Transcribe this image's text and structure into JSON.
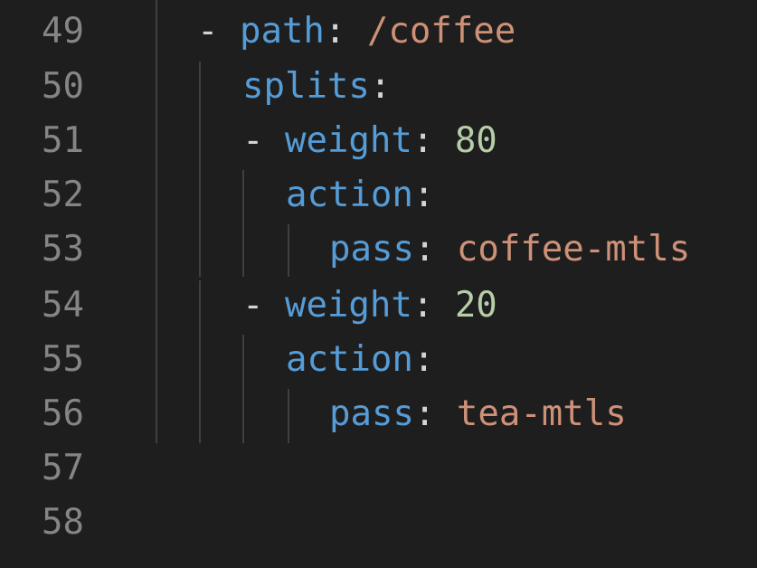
{
  "editor": {
    "colors": {
      "background": "#1e1e1e",
      "line_number": "#858585",
      "key": "#569cd6",
      "string": "#ce9178",
      "number": "#b5cea8",
      "punctuation": "#d4d4d4",
      "indent_guide": "#404040"
    },
    "lines": [
      {
        "number": "49",
        "dash": "- ",
        "key": "path",
        "colon": ": ",
        "value": "/coffee",
        "value_type": "string"
      },
      {
        "number": "50",
        "dash": "",
        "key": "splits",
        "colon": ":",
        "value": "",
        "value_type": "none"
      },
      {
        "number": "51",
        "dash": "- ",
        "key": "weight",
        "colon": ": ",
        "value": "80",
        "value_type": "number"
      },
      {
        "number": "52",
        "dash": "",
        "key": "action",
        "colon": ":",
        "value": "",
        "value_type": "none"
      },
      {
        "number": "53",
        "dash": "",
        "key": "pass",
        "colon": ": ",
        "value": "coffee-mtls",
        "value_type": "string"
      },
      {
        "number": "54",
        "dash": "- ",
        "key": "weight",
        "colon": ": ",
        "value": "20",
        "value_type": "number"
      },
      {
        "number": "55",
        "dash": "",
        "key": "action",
        "colon": ":",
        "value": "",
        "value_type": "none"
      },
      {
        "number": "56",
        "dash": "",
        "key": "pass",
        "colon": ": ",
        "value": "tea-mtls",
        "value_type": "string"
      },
      {
        "number": "57",
        "dash": "",
        "key": "",
        "colon": "",
        "value": "",
        "value_type": "none"
      },
      {
        "number": "58",
        "dash": "",
        "key": "",
        "colon": "",
        "value": "",
        "value_type": "none"
      }
    ]
  }
}
